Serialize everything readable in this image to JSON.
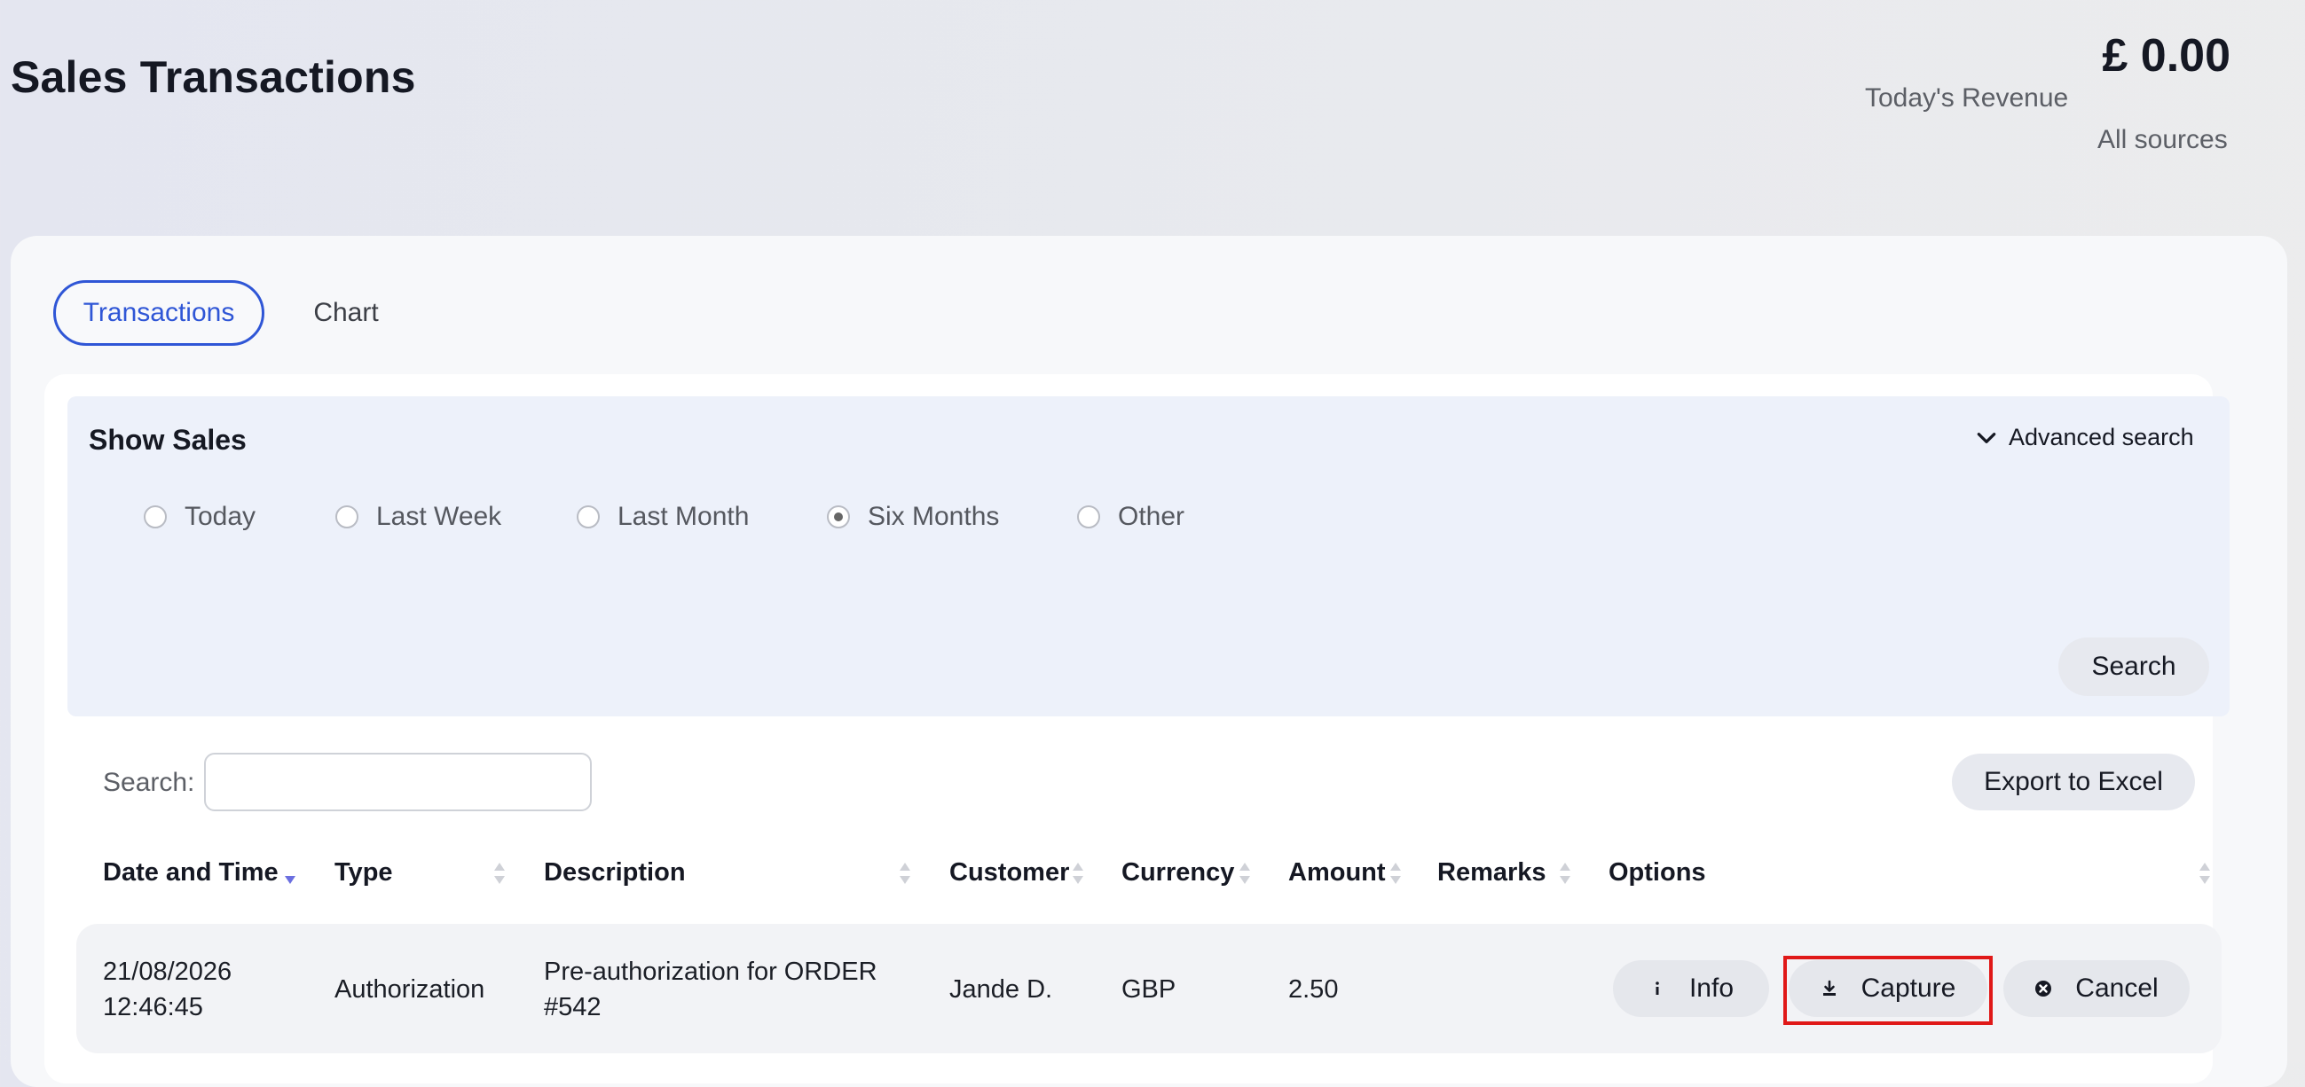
{
  "page": {
    "title": "Sales Transactions"
  },
  "revenue": {
    "amount": "£ 0.00",
    "label": "Today's Revenue",
    "sub_label": "All sources"
  },
  "tabs": [
    {
      "label": "Transactions",
      "active": true
    },
    {
      "label": "Chart",
      "active": false
    }
  ],
  "filter": {
    "title": "Show Sales",
    "advanced_label": "Advanced search",
    "options": [
      {
        "label": "Today",
        "selected": false
      },
      {
        "label": "Last Week",
        "selected": false
      },
      {
        "label": "Last Month",
        "selected": false
      },
      {
        "label": "Six Months",
        "selected": true
      },
      {
        "label": "Other",
        "selected": false
      }
    ],
    "search_button": "Search"
  },
  "table": {
    "search_label": "Search:",
    "search_value": "",
    "export_label": "Export to Excel",
    "columns": [
      "Date and Time",
      "Type",
      "Description",
      "Customer",
      "Currency",
      "Amount",
      "Remarks",
      "Options"
    ],
    "sort_column": "Date and Time",
    "sort_direction": "descending",
    "rows": [
      {
        "date": "21/08/2026",
        "time": "12:46:45",
        "type": "Authorization",
        "description_line1": "Pre-authorization for ORDER",
        "description_line2": "#542",
        "customer": "Jande D.",
        "currency": "GBP",
        "amount": "2.50",
        "remarks": "",
        "actions": [
          {
            "label": "Info",
            "icon": "info-icon"
          },
          {
            "label": "Capture",
            "icon": "download-icon",
            "highlighted": true
          },
          {
            "label": "Cancel",
            "icon": "cancel-circle-icon"
          }
        ]
      }
    ]
  },
  "colors": {
    "accent": "#2f56d6",
    "highlight": "#e01818",
    "panel": "#edf1fa",
    "sort_active": "#6b6fe0"
  }
}
